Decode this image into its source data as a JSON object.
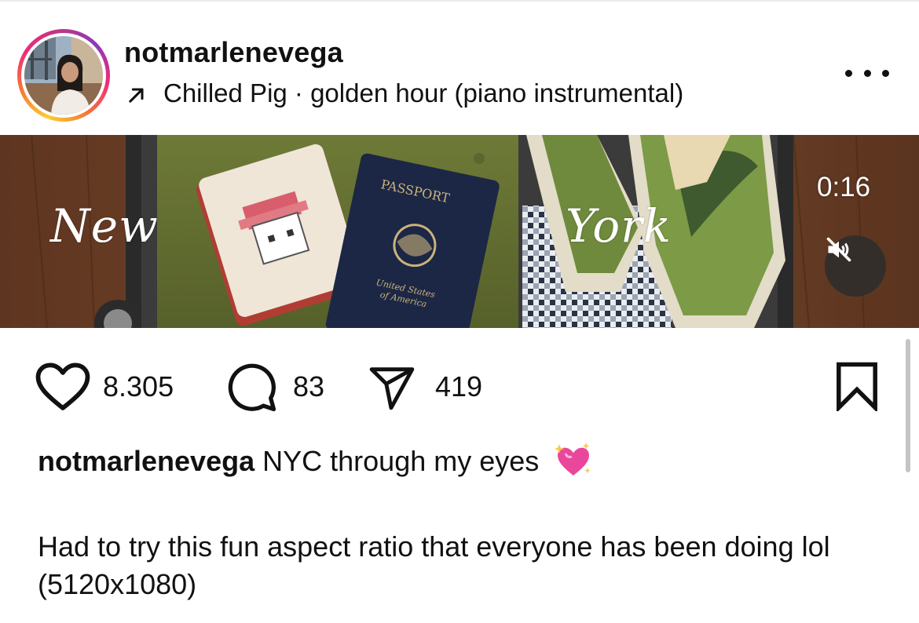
{
  "post": {
    "username": "notmarlenevega",
    "music": {
      "icon": "arrow-up-right-icon",
      "label": "Chilled Pig · golden hour (piano instrumental)"
    },
    "more_icon": "more-dots-icon"
  },
  "media": {
    "overlay_left": "New",
    "overlay_right": "York",
    "duration": "0:16",
    "mute_icon": "speaker-muted-icon"
  },
  "actions": {
    "likes": "8.305",
    "comments": "83",
    "shares": "419",
    "icons": [
      "heart-icon",
      "comment-icon",
      "share-icon",
      "bookmark-icon"
    ]
  },
  "caption": {
    "username": "notmarlenevega",
    "text": "NYC through my eyes",
    "emoji": "sparkling-heart-icon",
    "body": "Had to try this fun aspect ratio that everyone has been doing lol (5120x1080)"
  },
  "colors": {
    "ring_gradient": [
      "#f9ce34",
      "#ee2a7b",
      "#8a3ab9"
    ],
    "text": "#111111",
    "emoji_pink": "#e8479b"
  }
}
